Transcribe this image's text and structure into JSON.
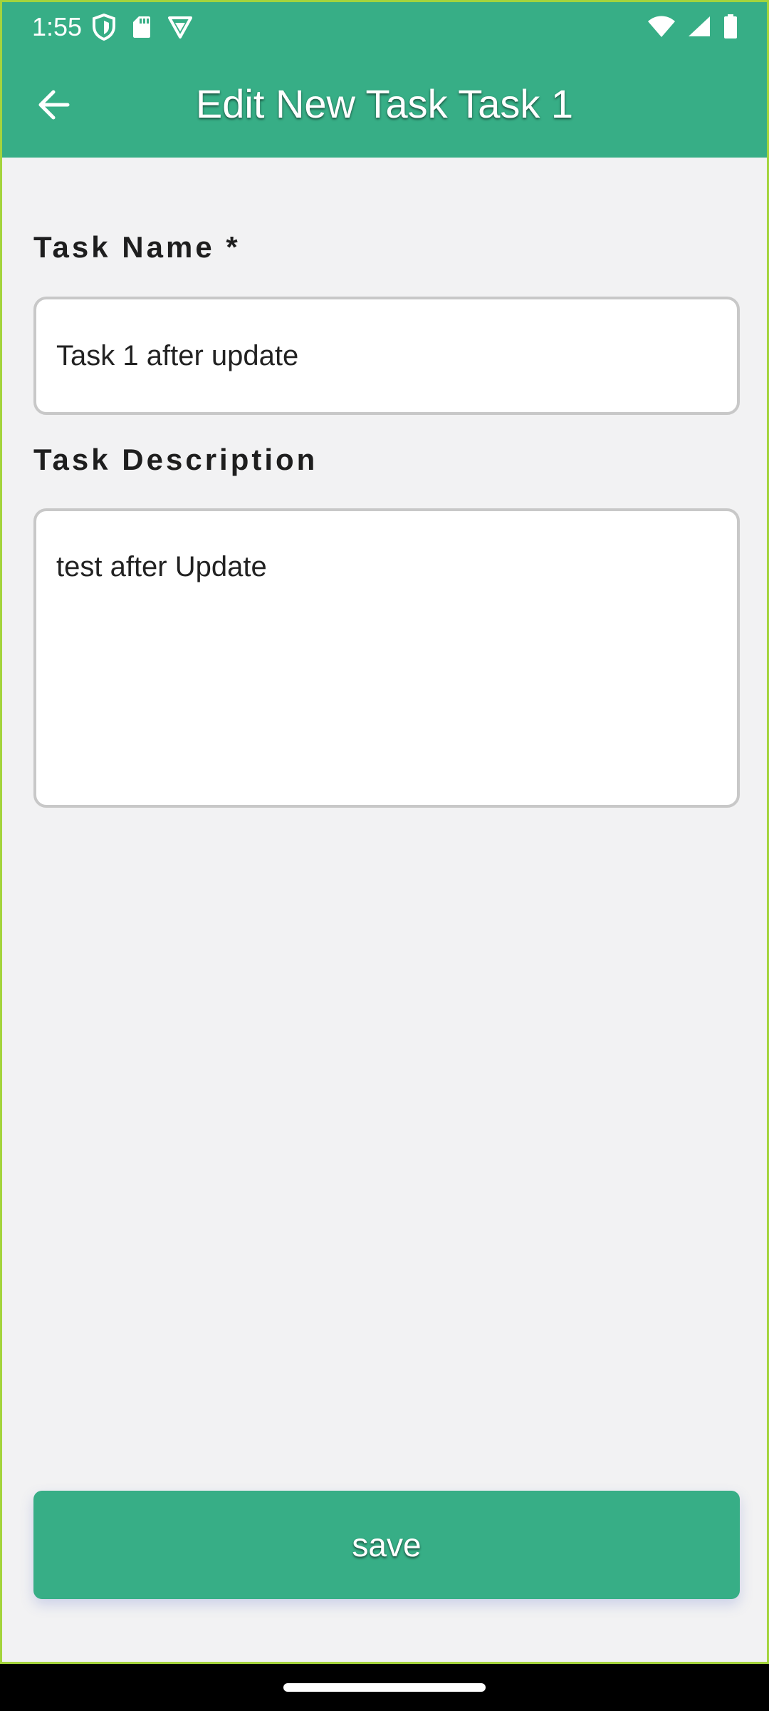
{
  "status_bar": {
    "time": "1:55",
    "left_icons": [
      "shield-icon",
      "sd-card-icon",
      "vpn-icon"
    ],
    "right_icons": [
      "wifi-icon",
      "signal-icon",
      "battery-icon"
    ]
  },
  "app_bar": {
    "title": "Edit New Task Task 1",
    "back_icon": "arrow-back-icon"
  },
  "form": {
    "task_name": {
      "label": "Task Name *",
      "value": "Task 1 after update"
    },
    "task_description": {
      "label": "Task Description",
      "value": "test after Update"
    }
  },
  "actions": {
    "save_label": "save"
  },
  "colors": {
    "primary": "#37ae86",
    "background": "#f2f2f3",
    "input_border": "#c8c8c8"
  }
}
